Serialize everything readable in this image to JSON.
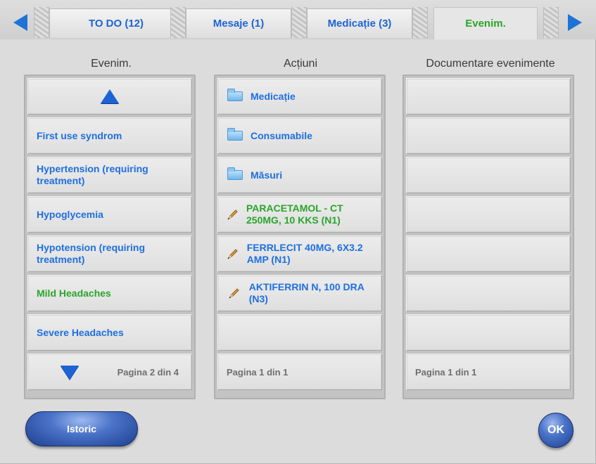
{
  "tabs": [
    {
      "label": "TO DO (12)",
      "active": false
    },
    {
      "label": "Mesaje (1)",
      "active": false
    },
    {
      "label": "Medicație (3)",
      "active": false
    },
    {
      "label": "Evenim.",
      "active": true
    }
  ],
  "colors": {
    "accent_blue": "#1e6fe0",
    "active_green": "#2aa52a",
    "footer_gray": "#6f6f6f",
    "button_blue": "#4a73c9"
  },
  "events_column": {
    "title": "Evenim.",
    "up_icon": "arrow-up-icon",
    "items": [
      {
        "label": "First use syndrom",
        "selected": false
      },
      {
        "label": "Hypertension (requiring treatment)",
        "selected": false
      },
      {
        "label": "Hypoglycemia",
        "selected": false
      },
      {
        "label": "Hypotension (requiring treatment)",
        "selected": false
      },
      {
        "label": "Mild Headaches",
        "selected": true
      },
      {
        "label": "Severe Headaches",
        "selected": false
      }
    ],
    "down_icon": "arrow-down-icon",
    "page_text": "Pagina 2 din 4"
  },
  "actions_column": {
    "title": "Acțiuni",
    "items": [
      {
        "label": "Medicație",
        "icon": "folder-icon",
        "selected": false
      },
      {
        "label": "Consumabile",
        "icon": "folder-icon",
        "selected": false
      },
      {
        "label": "Măsuri",
        "icon": "folder-icon",
        "selected": false
      },
      {
        "label": "PARACETAMOL - CT 250MG, 10 KKS (N1)",
        "icon": "pencil-icon",
        "selected": true
      },
      {
        "label": "FERRLECIT 40MG, 6X3.2 AMP (N1)",
        "icon": "pencil-icon",
        "selected": false
      },
      {
        "label": "AKTIFERRIN N, 100 DRA (N3)",
        "icon": "pencil-icon",
        "selected": false
      },
      {
        "label": "",
        "icon": "",
        "selected": false
      }
    ],
    "page_text": "Pagina 1 din 1"
  },
  "documentation_column": {
    "title": "Documentare evenimente",
    "rows": 7,
    "page_text": "Pagina 1 din 1"
  },
  "buttons": {
    "history_label": "Istoric",
    "ok_label": "OK"
  }
}
